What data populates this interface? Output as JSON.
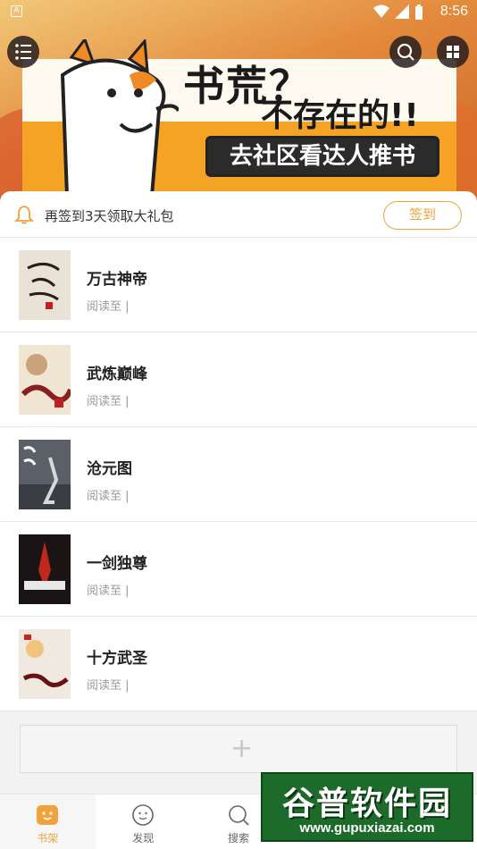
{
  "status_bar": {
    "time": "8:56",
    "sim_label": "A"
  },
  "banner": {
    "title": "书荒？",
    "subtitle": "不存在的!!",
    "cta": "去社区看达人推书"
  },
  "signin": {
    "text": "再签到3天领取大礼包",
    "button": "签到"
  },
  "books": [
    {
      "title": "万古神帝",
      "progress": "阅读至 |",
      "cover_color": "#e9e2d6"
    },
    {
      "title": "武炼巅峰",
      "progress": "阅读至 |",
      "cover_color": "#f1e6d4"
    },
    {
      "title": "沧元图",
      "progress": "阅读至 |",
      "cover_color": "#5a5f68"
    },
    {
      "title": "一剑独尊",
      "progress": "阅读至 |",
      "cover_color": "#1b1414"
    },
    {
      "title": "十方武圣",
      "progress": "阅读至 |",
      "cover_color": "#efe9df"
    }
  ],
  "add_button": {
    "icon": "plus-icon"
  },
  "tabs": [
    {
      "label": "书架",
      "icon": "bookshelf-icon",
      "active": true
    },
    {
      "label": "发现",
      "icon": "discover-icon",
      "active": false
    },
    {
      "label": "搜索",
      "icon": "search-icon",
      "active": false
    },
    {
      "label": "",
      "icon": "community-icon",
      "active": false
    },
    {
      "label": "",
      "icon": "profile-icon",
      "active": false
    }
  ],
  "watermark": {
    "text": "谷普软件园",
    "url": "www.gupuxiazai.com"
  },
  "colors": {
    "accent": "#f0a33c",
    "divider": "#e6e6e6"
  }
}
